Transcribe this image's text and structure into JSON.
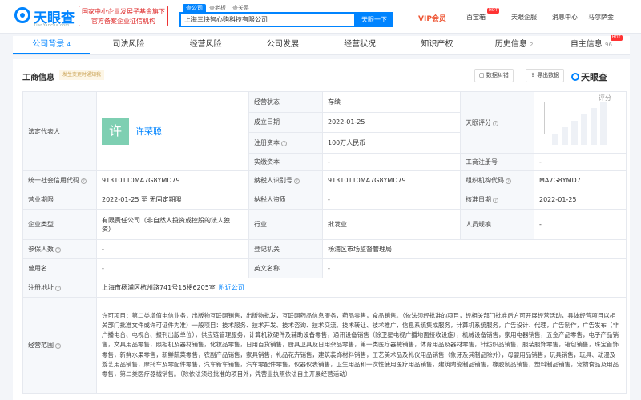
{
  "header": {
    "logo": "天眼查",
    "logo_sub": "TianYancha.com",
    "badge_line1": "国家中小企业发展子基金旗下",
    "badge_line2": "官方备案企业征信机构",
    "search_tabs": [
      "查公司",
      "查老板",
      "查关系"
    ],
    "search_value": "上海三快智心购科技有限公司",
    "search_button": "天眼一下",
    "vip": "VIP会员",
    "nav": [
      "百宝箱",
      "天眼企服",
      "消息中心",
      "马尔萨金"
    ],
    "hot": "HOT"
  },
  "tabs": [
    {
      "label": "公司背景",
      "count": "4"
    },
    {
      "label": "司法风险",
      "count": ""
    },
    {
      "label": "经营风险",
      "count": ""
    },
    {
      "label": "公司发展",
      "count": ""
    },
    {
      "label": "经营状况",
      "count": ""
    },
    {
      "label": "知识产权",
      "count": ""
    },
    {
      "label": "历史信息",
      "count": "2"
    },
    {
      "label": "自主信息",
      "count": "96"
    }
  ],
  "section": {
    "title": "工商信息",
    "notice": "发生变更时通知我",
    "btn_correct": "数据纠错",
    "btn_export": "导出数据",
    "brand": "天眼查"
  },
  "info": {
    "legal_rep_label": "法定代表人",
    "avatar_char": "许",
    "legal_rep_name": "许荣聪",
    "status_label": "经营状态",
    "status_value": "存续",
    "estab_label": "成立日期",
    "estab_value": "2022-01-25",
    "reg_cap_label": "注册资本",
    "reg_cap_value": "100万人民币",
    "paid_cap_label": "实缴资本",
    "paid_cap_value": "-",
    "tyc_score_label": "天眼评分",
    "tyc_score_text": "评分",
    "reg_no_label": "工商注册号",
    "reg_no_value": "-",
    "credit_code_label": "统一社会信用代码",
    "credit_code_value": "91310110MA7G8YMD79",
    "tax_id_label": "纳税人识别号",
    "tax_id_value": "91310110MA7G8YMD79",
    "org_code_label": "组织机构代码",
    "org_code_value": "MA7G8YMD7",
    "term_label": "营业期限",
    "term_value": "2022-01-25 至 无固定期限",
    "taxpayer_label": "纳税人资质",
    "taxpayer_value": "-",
    "approve_label": "核准日期",
    "approve_value": "2022-01-25",
    "type_label": "企业类型",
    "type_value_1": "有限责任公司（非自然人投资或控股的法人独",
    "type_value_2": "资）",
    "industry_label": "行业",
    "industry_value": "批发业",
    "staff_label": "人员规模",
    "staff_value": "-",
    "insured_label": "参保人数",
    "insured_value": "-",
    "authority_label": "登记机关",
    "authority_value": "杨浦区市场监督管理局",
    "former_label": "曾用名",
    "former_value": "-",
    "en_name_label": "英文名称",
    "en_name_value": "-",
    "address_label": "注册地址",
    "address_value": "上海市杨浦区杭州路741号16楼6205室",
    "address_link": "附近公司",
    "scope_label": "经营范围",
    "scope_value": "许可项目：第二类增值电信业务，出版物互联网销售，出版物批发，互联网药品信息服务，药品零售，食品销售。（依法须经批准的项目，经相关部门批准后方可开展经营活动，具体经营项目以相关部门批准文件或许可证件为准）一般项目：技术服务、技术开发、技术咨询、技术交流、技术转让、技术推广，信息系统集成服务，计算机系统服务，广告设计、代理，广告制作，广告发布（非广播电台、电视台、报刊出版单位），供应链管理服务，计算机软硬件及辅助设备零售，通讯设备销售（除卫星电视广播地面接收设施），机械设备销售，家用电器销售，五金产品零售，电子产品销售，文具用品零售，照相机及器材销售，化妆品零售，日用百货销售，厨具卫具及日用杂品零售，第一类医疗器械销售，体育用品及器材零售，针纺织品销售，服装服饰零售，箱包销售，珠宝首饰零售，新鲜水果零售，新鲜蔬菜零售，农副产品销售，家具销售，礼品花卉销售，建筑装饰材料销售，工艺美术品及礼仪用品销售（象牙及其制品除外），母婴用品销售，玩具销售，玩具、动漫及游艺用品销售，摩托车及零配件零售，汽车新车销售，汽车零配件零售，仪器仪表销售，卫生用品和一次性使用医疗用品销售，建筑陶瓷制品销售，橡胶制品销售，塑料制品销售，宠物食品及用品零售，第二类医疗器械销售。（除依法须经批准的项目外，凭营业执照依法自主开展经营活动）"
  }
}
